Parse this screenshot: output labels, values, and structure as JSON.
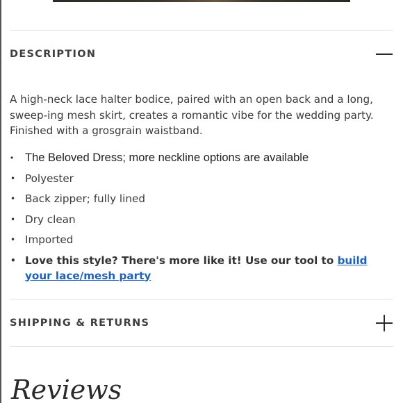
{
  "description_section": {
    "title": "DESCRIPTION",
    "toggle_icon": "minus-icon",
    "body": "A high-neck lace halter bodice, paired with an open back and a long, sweep-ing mesh skirt, creates a romantic vibe for the wedding party. Finished with a grosgrain waistband.",
    "features": [
      "The Beloved Dress; more neckline options are available",
      "Polyester",
      "Back zipper; fully lined",
      "Dry clean",
      "Imported"
    ],
    "promo_text": "Love this style? There's more like it! Use our tool to",
    "promo_link_text": "build your lace/mesh party"
  },
  "shipping_section": {
    "title": "SHIPPING & RETURNS",
    "toggle_icon": "plus-icon"
  },
  "reviews": {
    "title": "Reviews"
  },
  "colors": {
    "link": "#1e63b8",
    "text": "#3a3a3a",
    "divider": "#e2e2e2"
  }
}
